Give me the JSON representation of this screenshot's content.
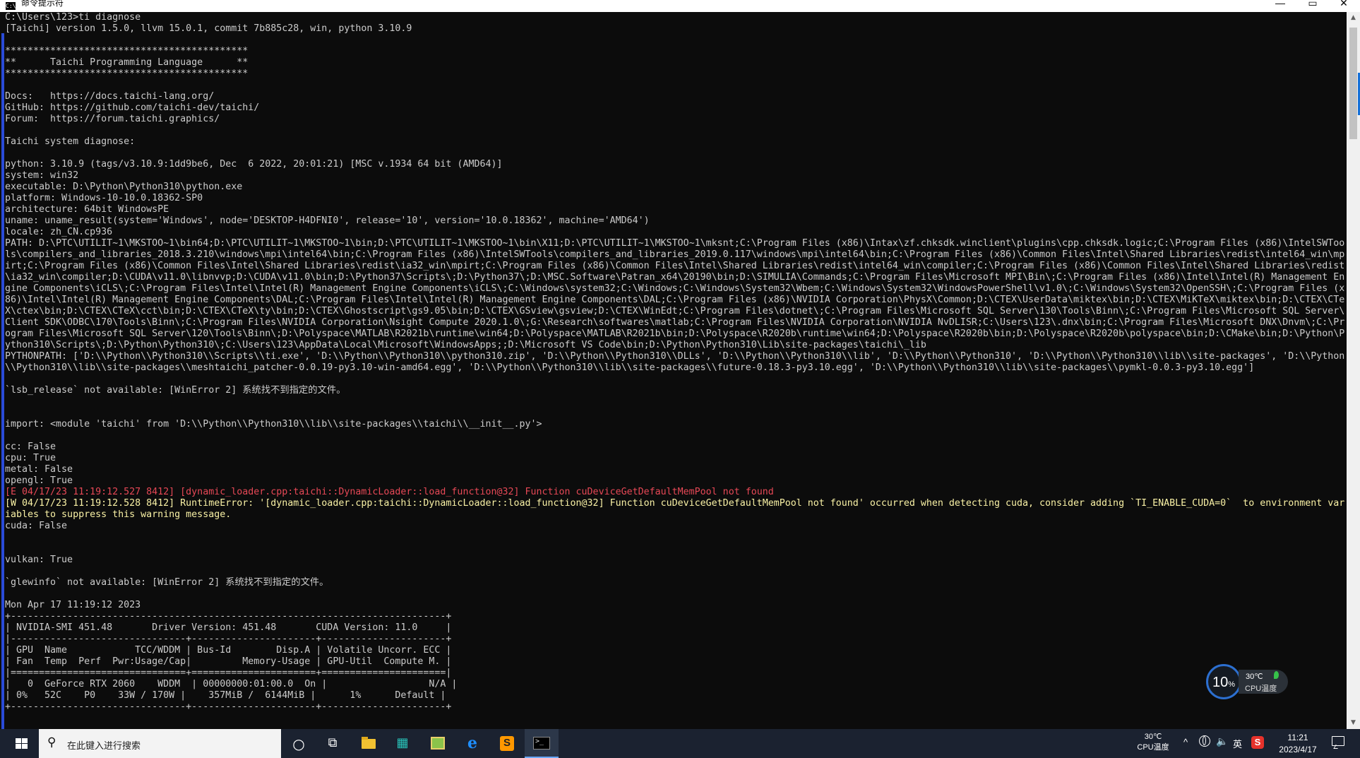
{
  "window": {
    "title": "命令提示符",
    "icon_label": "C:\\",
    "controls": {
      "minimize": "—",
      "maximize": "▭",
      "close": "✕"
    }
  },
  "console": {
    "lines": [
      {
        "text": "C:\\Users\\123>ti diagnose",
        "type": "normal"
      },
      {
        "text": "[Taichi] version 1.5.0, llvm 15.0.1, commit 7b885c28, win, python 3.10.9",
        "type": "normal"
      },
      {
        "text": "",
        "type": "normal"
      },
      {
        "text": "*******************************************",
        "type": "normal"
      },
      {
        "text": "**      Taichi Programming Language      **",
        "type": "normal"
      },
      {
        "text": "*******************************************",
        "type": "normal"
      },
      {
        "text": "",
        "type": "normal"
      },
      {
        "text": "Docs:   https://docs.taichi-lang.org/",
        "type": "normal"
      },
      {
        "text": "GitHub: https://github.com/taichi-dev/taichi/",
        "type": "normal"
      },
      {
        "text": "Forum:  https://forum.taichi.graphics/",
        "type": "normal"
      },
      {
        "text": "",
        "type": "normal"
      },
      {
        "text": "Taichi system diagnose:",
        "type": "normal"
      },
      {
        "text": "",
        "type": "normal"
      },
      {
        "text": "python: 3.10.9 (tags/v3.10.9:1dd9be6, Dec  6 2022, 20:01:21) [MSC v.1934 64 bit (AMD64)]",
        "type": "normal"
      },
      {
        "text": "system: win32",
        "type": "normal"
      },
      {
        "text": "executable: D:\\Python\\Python310\\python.exe",
        "type": "normal"
      },
      {
        "text": "platform: Windows-10-10.0.18362-SP0",
        "type": "normal"
      },
      {
        "text": "architecture: 64bit WindowsPE",
        "type": "normal"
      },
      {
        "text": "uname: uname_result(system='Windows', node='DESKTOP-H4DFNI0', release='10', version='10.0.18362', machine='AMD64')",
        "type": "normal"
      },
      {
        "text": "locale: zh_CN.cp936",
        "type": "normal"
      },
      {
        "text": "PATH: D:\\PTC\\UTILIT~1\\MKSTOO~1\\bin64;D:\\PTC\\UTILIT~1\\MKSTOO~1\\bin;D:\\PTC\\UTILIT~1\\MKSTOO~1\\bin\\X11;D:\\PTC\\UTILIT~1\\MKSTOO~1\\mksnt;C:\\Program Files (x86)\\Intax\\zf.chksdk.winclient\\plugins\\cpp.chksdk.logic;C:\\Program Files (x86)\\IntelSWToo",
        "type": "normal"
      },
      {
        "text": "ls\\compilers_and_libraries_2018.3.210\\windows\\mpi\\intel64\\bin;C:\\Program Files (x86)\\IntelSWTools\\compilers_and_libraries_2019.0.117\\windows\\mpi\\intel64\\bin;C:\\Program Files (x86)\\Common Files\\Intel\\Shared Libraries\\redist\\intel64_win\\mp",
        "type": "normal"
      },
      {
        "text": "irt;C:\\Program Files (x86)\\Common Files\\Intel\\Shared Libraries\\redist\\ia32_win\\mpirt;C:\\Program Files (x86)\\Common Files\\Intel\\Shared Libraries\\redist\\intel64_win\\compiler;C:\\Program Files (x86)\\Common Files\\Intel\\Shared Libraries\\redist",
        "type": "normal"
      },
      {
        "text": "\\ia32_win\\compiler;D:\\CUDA\\v11.0\\libnvvp;D:\\CUDA\\v11.0\\bin;D:\\Python37\\Scripts\\;D:\\Python37\\;D:\\MSC.Software\\Patran_x64\\20190\\bin;D:\\SIMULIA\\Commands;C:\\Program Files\\Microsoft MPI\\Bin\\;C:\\Program Files (x86)\\Intel\\Intel(R) Management En",
        "type": "normal"
      },
      {
        "text": "gine Components\\iCLS\\;C:\\Program Files\\Intel\\Intel(R) Management Engine Components\\iCLS\\;C:\\Windows\\system32;C:\\Windows;C:\\Windows\\System32\\Wbem;C:\\Windows\\System32\\WindowsPowerShell\\v1.0\\;C:\\Windows\\System32\\OpenSSH\\;C:\\Program Files (x",
        "type": "normal"
      },
      {
        "text": "86)\\Intel\\Intel(R) Management Engine Components\\DAL;C:\\Program Files\\Intel\\Intel(R) Management Engine Components\\DAL;C:\\Program Files (x86)\\NVIDIA Corporation\\PhysX\\Common;D:\\CTEX\\UserData\\miktex\\bin;D:\\CTEX\\MiKTeX\\miktex\\bin;D:\\CTEX\\CTe",
        "type": "normal"
      },
      {
        "text": "X\\ctex\\bin;D:\\CTEX\\CTeX\\cct\\bin;D:\\CTEX\\CTeX\\ty\\bin;D:\\CTEX\\Ghostscript\\gs9.05\\bin;D:\\CTEX\\GSview\\gsview;D:\\CTEX\\WinEdt;C:\\Program Files\\dotnet\\;C:\\Program Files\\Microsoft SQL Server\\130\\Tools\\Binn\\;C:\\Program Files\\Microsoft SQL Server\\",
        "type": "normal"
      },
      {
        "text": "Client SDK\\ODBC\\170\\Tools\\Binn\\;C:\\Program Files\\NVIDIA Corporation\\Nsight Compute 2020.1.0\\;G:\\Research\\softwares\\matlab;C:\\Program Files\\NVIDIA Corporation\\NVIDIA NvDLISR;C:\\Users\\123\\.dnx\\bin;C:\\Program Files\\Microsoft DNX\\Dnvm\\;C:\\Pr",
        "type": "normal"
      },
      {
        "text": "ogram Files\\Microsoft SQL Server\\120\\Tools\\Binn\\;D:\\Polyspace\\MATLAB\\R2021b\\runtime\\win64;D:\\Polyspace\\MATLAB\\R2021b\\bin;D:\\Polyspace\\R2020b\\runtime\\win64;D:\\Polyspace\\R2020b\\bin;D:\\Polyspace\\R2020b\\polyspace\\bin;D:\\CMake\\bin;D:\\Python\\P",
        "type": "normal"
      },
      {
        "text": "ython310\\Scripts\\;D:\\Python\\Python310\\;C:\\Users\\123\\AppData\\Local\\Microsoft\\WindowsApps;;D:\\Microsoft VS Code\\bin;D:\\Python\\Python310\\Lib\\site-packages\\taichi\\_lib",
        "type": "normal"
      },
      {
        "text": "PYTHONPATH: ['D:\\\\Python\\\\Python310\\\\Scripts\\\\ti.exe', 'D:\\\\Python\\\\Python310\\\\python310.zip', 'D:\\\\Python\\\\Python310\\\\DLLs', 'D:\\\\Python\\\\Python310\\\\lib', 'D:\\\\Python\\\\Python310', 'D:\\\\Python\\\\Python310\\\\lib\\\\site-packages', 'D:\\\\Python",
        "type": "normal"
      },
      {
        "text": "\\\\Python310\\\\lib\\\\site-packages\\\\meshtaichi_patcher-0.0.19-py3.10-win-amd64.egg', 'D:\\\\Python\\\\Python310\\\\lib\\\\site-packages\\\\future-0.18.3-py3.10.egg', 'D:\\\\Python\\\\Python310\\\\lib\\\\site-packages\\\\pymkl-0.0.3-py3.10.egg']",
        "type": "normal"
      },
      {
        "text": "",
        "type": "normal"
      },
      {
        "text": "`lsb_release` not available: [WinError 2] 系统找不到指定的文件。",
        "type": "normal"
      },
      {
        "text": "",
        "type": "normal"
      },
      {
        "text": "",
        "type": "normal"
      },
      {
        "text": "import: <module 'taichi' from 'D:\\\\Python\\\\Python310\\\\lib\\\\site-packages\\\\taichi\\\\__init__.py'>",
        "type": "normal"
      },
      {
        "text": "",
        "type": "normal"
      },
      {
        "text": "cc: False",
        "type": "normal"
      },
      {
        "text": "cpu: True",
        "type": "normal"
      },
      {
        "text": "metal: False",
        "type": "normal"
      },
      {
        "text": "opengl: True",
        "type": "normal"
      },
      {
        "text": "[E 04/17/23 11:19:12.527 8412] [dynamic_loader.cpp:taichi::DynamicLoader::load_function@32] Function cuDeviceGetDefaultMemPool not found",
        "type": "err"
      },
      {
        "text": "[W 04/17/23 11:19:12.528 8412] RuntimeError: '[dynamic_loader.cpp:taichi::DynamicLoader::load_function@32] Function cuDeviceGetDefaultMemPool not found' occurred when detecting cuda, consider adding `TI_ENABLE_CUDA=0`  to environment var",
        "type": "warn"
      },
      {
        "text": "iables to suppress this warning message.",
        "type": "warn"
      },
      {
        "text": "cuda: False",
        "type": "normal"
      },
      {
        "text": "",
        "type": "normal"
      },
      {
        "text": "",
        "type": "normal"
      },
      {
        "text": "vulkan: True",
        "type": "normal"
      },
      {
        "text": "",
        "type": "normal"
      },
      {
        "text": "`glewinfo` not available: [WinError 2] 系统找不到指定的文件。",
        "type": "normal"
      },
      {
        "text": "",
        "type": "normal"
      },
      {
        "text": "Mon Apr 17 11:19:12 2023",
        "type": "normal"
      },
      {
        "text": "+-----------------------------------------------------------------------------+",
        "type": "normal"
      },
      {
        "text": "| NVIDIA-SMI 451.48       Driver Version: 451.48       CUDA Version: 11.0     |",
        "type": "normal"
      },
      {
        "text": "|-------------------------------+----------------------+----------------------+",
        "type": "normal"
      },
      {
        "text": "| GPU  Name            TCC/WDDM | Bus-Id        Disp.A | Volatile Uncorr. ECC |",
        "type": "normal"
      },
      {
        "text": "| Fan  Temp  Perf  Pwr:Usage/Cap|         Memory-Usage | GPU-Util  Compute M. |",
        "type": "normal"
      },
      {
        "text": "|===============================+======================+======================|",
        "type": "normal"
      },
      {
        "text": "|   0  GeForce RTX 2060    WDDM  | 00000000:01:00.0  On |                  N/A |",
        "type": "normal"
      },
      {
        "text": "| 0%   52C    P0    33W / 170W |    357MiB /  6144MiB |      1%      Default |",
        "type": "normal"
      },
      {
        "text": "+-------------------------------+----------------------+----------------------+",
        "type": "normal"
      }
    ]
  },
  "cpu_widget": {
    "percent": "10",
    "percent_unit": "%",
    "temperature": "30℃",
    "label": "CPU温度"
  },
  "taskbar": {
    "search_placeholder": "在此键入进行搜索",
    "icons": {
      "cortana": "○",
      "task_view": "⧉",
      "app_grid": "▦",
      "edge": "e"
    },
    "tray": {
      "cpu_temp": "30℃",
      "cpu_temp_label": "CPU温度",
      "chevron": "^",
      "volume": "🔈",
      "ime": "英",
      "sogou": "S",
      "time": "11:21",
      "date": "2023/4/17"
    }
  },
  "colors": {
    "console_bg": "#0c0c0c",
    "console_text": "#cccccc",
    "error_text": "#e74856",
    "warning_text": "#f9f1a5",
    "taskbar_bg": "#1b2230"
  }
}
